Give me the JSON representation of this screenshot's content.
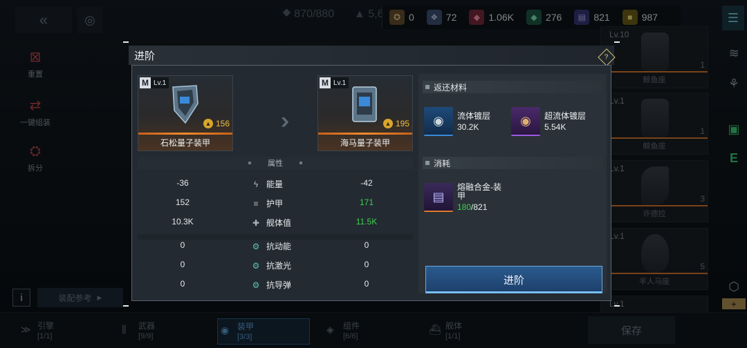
{
  "topbar": {
    "energy_stat": "870/880",
    "power_stat": "5,6",
    "power_stat_tail": "5",
    "resources": [
      {
        "icon": "crest-icon",
        "value": "0",
        "color": "#c79b5a"
      },
      {
        "icon": "crystal-cluster-icon",
        "value": "72",
        "color": "#8fa9d8"
      },
      {
        "icon": "pink-crystal-icon",
        "value": "1.06K",
        "color": "#e0607a"
      },
      {
        "icon": "green-crystal-icon",
        "value": "276",
        "color": "#3fb58a"
      },
      {
        "icon": "blueprint-book-icon",
        "value": "821",
        "color": "#7f7fd8"
      },
      {
        "icon": "gold-cube-icon",
        "value": "987",
        "color": "#d7c03a"
      }
    ]
  },
  "sidebar": {
    "items": [
      {
        "label": "重置",
        "icon": "reset-icon"
      },
      {
        "label": "一键组装",
        "icon": "auto-assemble-icon"
      },
      {
        "label": "拆分",
        "icon": "split-icon"
      }
    ],
    "info_label": "i",
    "reference_label": "装配参考"
  },
  "inventory": [
    {
      "lv": "Lv.10",
      "count": "1",
      "name": "鲸鱼座"
    },
    {
      "lv": "Lv.1",
      "count": "1",
      "name": "鲸鱼座"
    },
    {
      "lv": "Lv.1",
      "count": "3",
      "name": "许德拉"
    },
    {
      "lv": "Lv.1",
      "count": "5",
      "name": "半人马座"
    },
    {
      "lv": "Lv.1",
      "count": "",
      "name": ""
    }
  ],
  "bottombar": {
    "tabs": [
      {
        "label": "引擎",
        "sub": "[1/1]"
      },
      {
        "label": "武器",
        "sub": "[9/9]"
      },
      {
        "label": "装甲",
        "sub": "[3/3]"
      },
      {
        "label": "组件",
        "sub": "[6/6]"
      },
      {
        "label": "舰体",
        "sub": "[1/1]"
      }
    ],
    "save_label": "保存"
  },
  "modal": {
    "title": "进阶",
    "from_item": {
      "grade": "M",
      "lv": "Lv.1",
      "cost": "156",
      "name": "石松量子装甲"
    },
    "to_item": {
      "grade": "M",
      "lv": "Lv.1",
      "cost": "195",
      "name": "海马量子装甲"
    },
    "attr_header": "属性",
    "attributes": [
      {
        "from": "-36",
        "icon": "energy-icon",
        "label": "能量",
        "to": "-42",
        "changed": false
      },
      {
        "from": "152",
        "icon": "armor-icon",
        "label": "护甲",
        "to": "171",
        "changed": true
      },
      {
        "from": "10.3K",
        "icon": "hull-icon",
        "label": "舰体值",
        "to": "11.5K",
        "changed": true
      }
    ],
    "resistances": [
      {
        "from": "0",
        "icon": "kinetic-resist-icon",
        "label": "抗动能",
        "to": "0"
      },
      {
        "from": "0",
        "icon": "laser-resist-icon",
        "label": "抗激光",
        "to": "0"
      },
      {
        "from": "0",
        "icon": "missile-resist-icon",
        "label": "抗导弹",
        "to": "0"
      }
    ],
    "refund_header": "返还材料",
    "refund": [
      {
        "name": "流体镀层",
        "value": "30.2K",
        "icon": "fluid-coating-icon"
      },
      {
        "name": "超流体镀层",
        "value": "5.54K",
        "icon": "superfluid-coating-icon"
      }
    ],
    "consume_header": "消耗",
    "consume": {
      "name_line1": "熔融合金-装",
      "name_line2": "甲",
      "have": "180",
      "need": "/821"
    },
    "advance_label": "进阶"
  }
}
